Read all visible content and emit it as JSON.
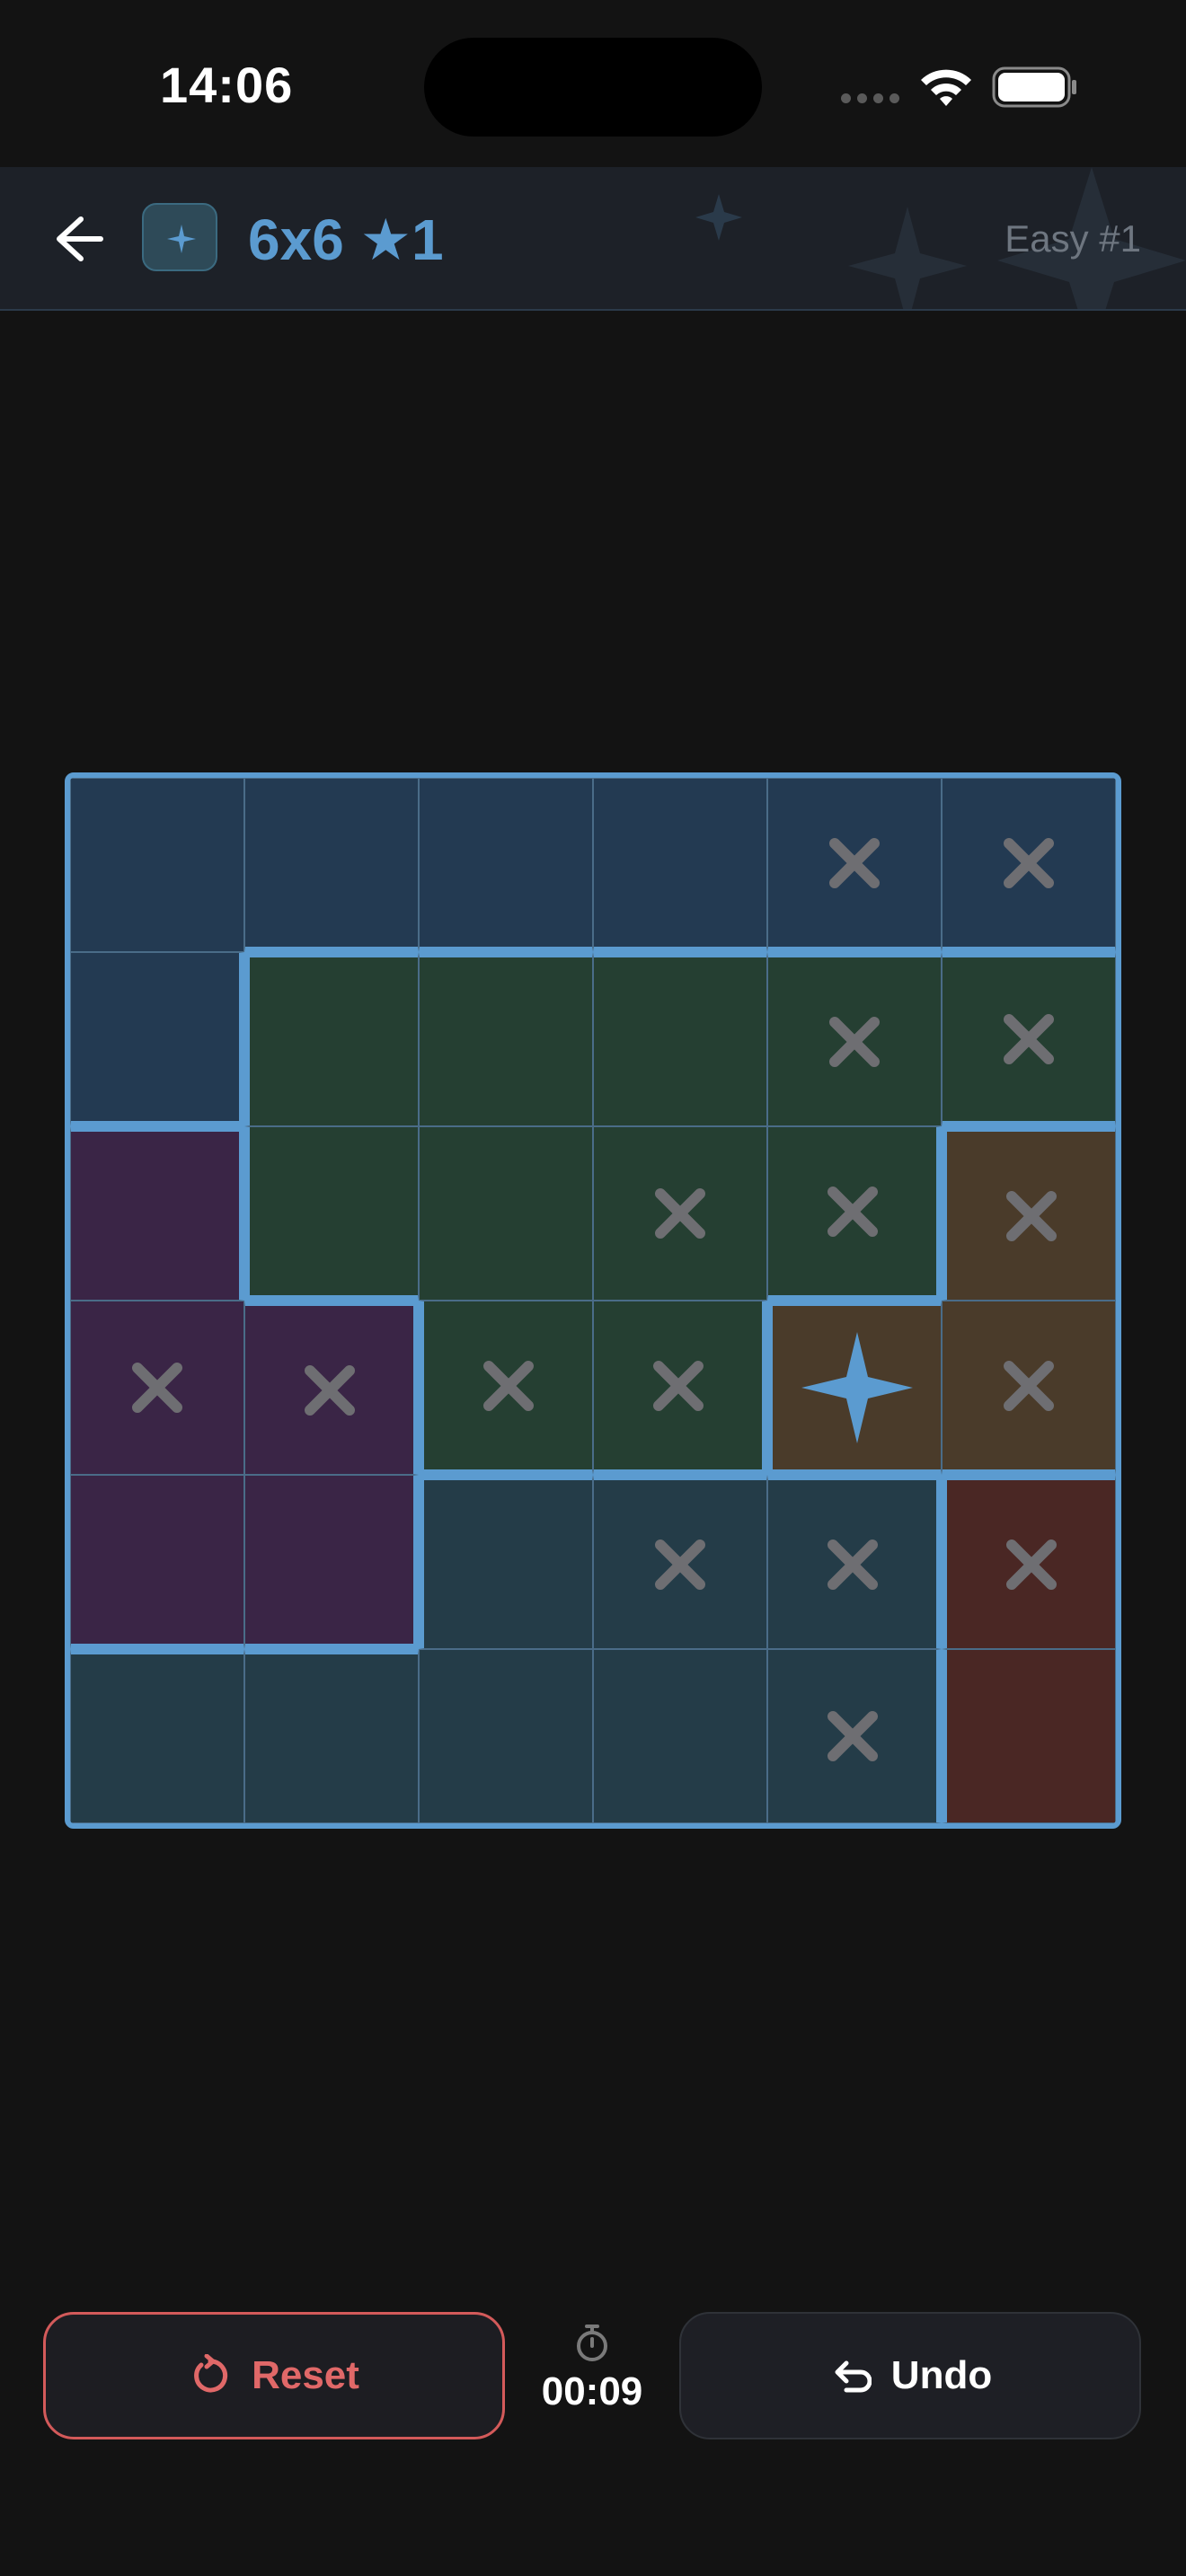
{
  "status_bar": {
    "time": "14:06"
  },
  "header": {
    "title": "6x6 ★1",
    "difficulty": "Easy #1"
  },
  "colors": {
    "accent": "#5b9bd0",
    "region_blue": "#233a52",
    "region_green": "#253f32",
    "region_purple": "#3a2546",
    "region_brown": "#4a3b2a",
    "region_teal": "#243c48",
    "region_red": "#4a2724",
    "x_mark": "#6e6e72",
    "reset": "#e06868"
  },
  "board": {
    "size": 6,
    "regions": [
      [
        "blue",
        "blue",
        "blue",
        "blue",
        "blue",
        "blue"
      ],
      [
        "blue",
        "green",
        "green",
        "green",
        "green",
        "green"
      ],
      [
        "purple",
        "green",
        "green",
        "green",
        "green",
        "brown"
      ],
      [
        "purple",
        "purple",
        "green",
        "green",
        "brown",
        "brown"
      ],
      [
        "purple",
        "purple",
        "teal",
        "teal",
        "teal",
        "red"
      ],
      [
        "teal",
        "teal",
        "teal",
        "teal",
        "teal",
        "red"
      ]
    ],
    "marks": [
      [
        "",
        "",
        "",
        "",
        "x",
        "x"
      ],
      [
        "",
        "",
        "",
        "",
        "x",
        "x"
      ],
      [
        "",
        "",
        "",
        "x",
        "x",
        "x"
      ],
      [
        "x",
        "x",
        "x",
        "x",
        "star",
        "x"
      ],
      [
        "",
        "",
        "",
        "x",
        "x",
        "x"
      ],
      [
        "",
        "",
        "",
        "",
        "x",
        ""
      ]
    ]
  },
  "controls": {
    "reset_label": "Reset",
    "undo_label": "Undo",
    "reset_icon": "rotate-ccw-icon",
    "undo_icon": "undo-icon",
    "timer_icon": "stopwatch-icon",
    "timer_value": "00:09"
  }
}
